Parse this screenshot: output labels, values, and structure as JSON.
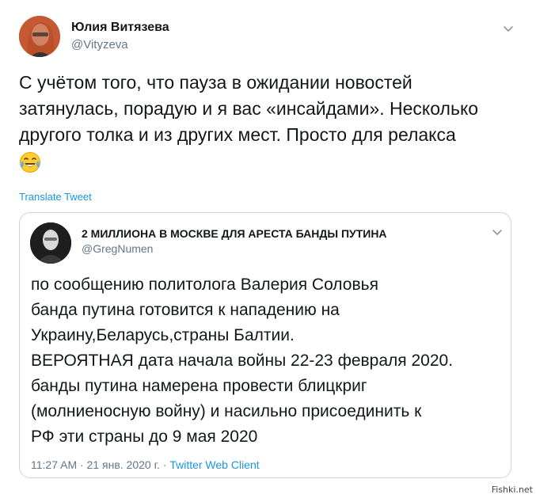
{
  "author": {
    "name": "Юлия Витязева",
    "handle": "@Vityzeva"
  },
  "tweet": {
    "lines": [
      "С учётом того, что пауза в ожидании новостей",
      "затянулась, порадую и я вас «инсайдами». Несколько",
      "другого толка и из других мест. Просто для релакса"
    ],
    "emoji": "face-with-tears-of-joy"
  },
  "translate_label": "Translate Tweet",
  "quoted": {
    "name": "2 МИЛЛИОНА В МОСКВЕ ДЛЯ АРЕСТА БАНДЫ ПУТИНА",
    "handle": "@GregNumen",
    "lines": [
      "по сообщению политолога Валерия Соловья",
      "банда путина готовится к нападению на",
      "Украину,Беларусь,страны Балтии.",
      "ВЕРОЯТНАЯ дата начала войны 22-23 февраля 2020.",
      "банды путина намерена провести блицкриг",
      "(молниеносную войну) и насильно присоединить к",
      "РФ эти страны до 9 мая 2020"
    ],
    "timestamp": "11:27 AM · 21 янв. 2020 г. · ",
    "client": "Twitter Web Client"
  },
  "watermark": "Fishki.net",
  "colors": {
    "text": "#14171a",
    "secondary": "#657786",
    "link": "#1b95e0",
    "border": "#ccd6dd"
  }
}
